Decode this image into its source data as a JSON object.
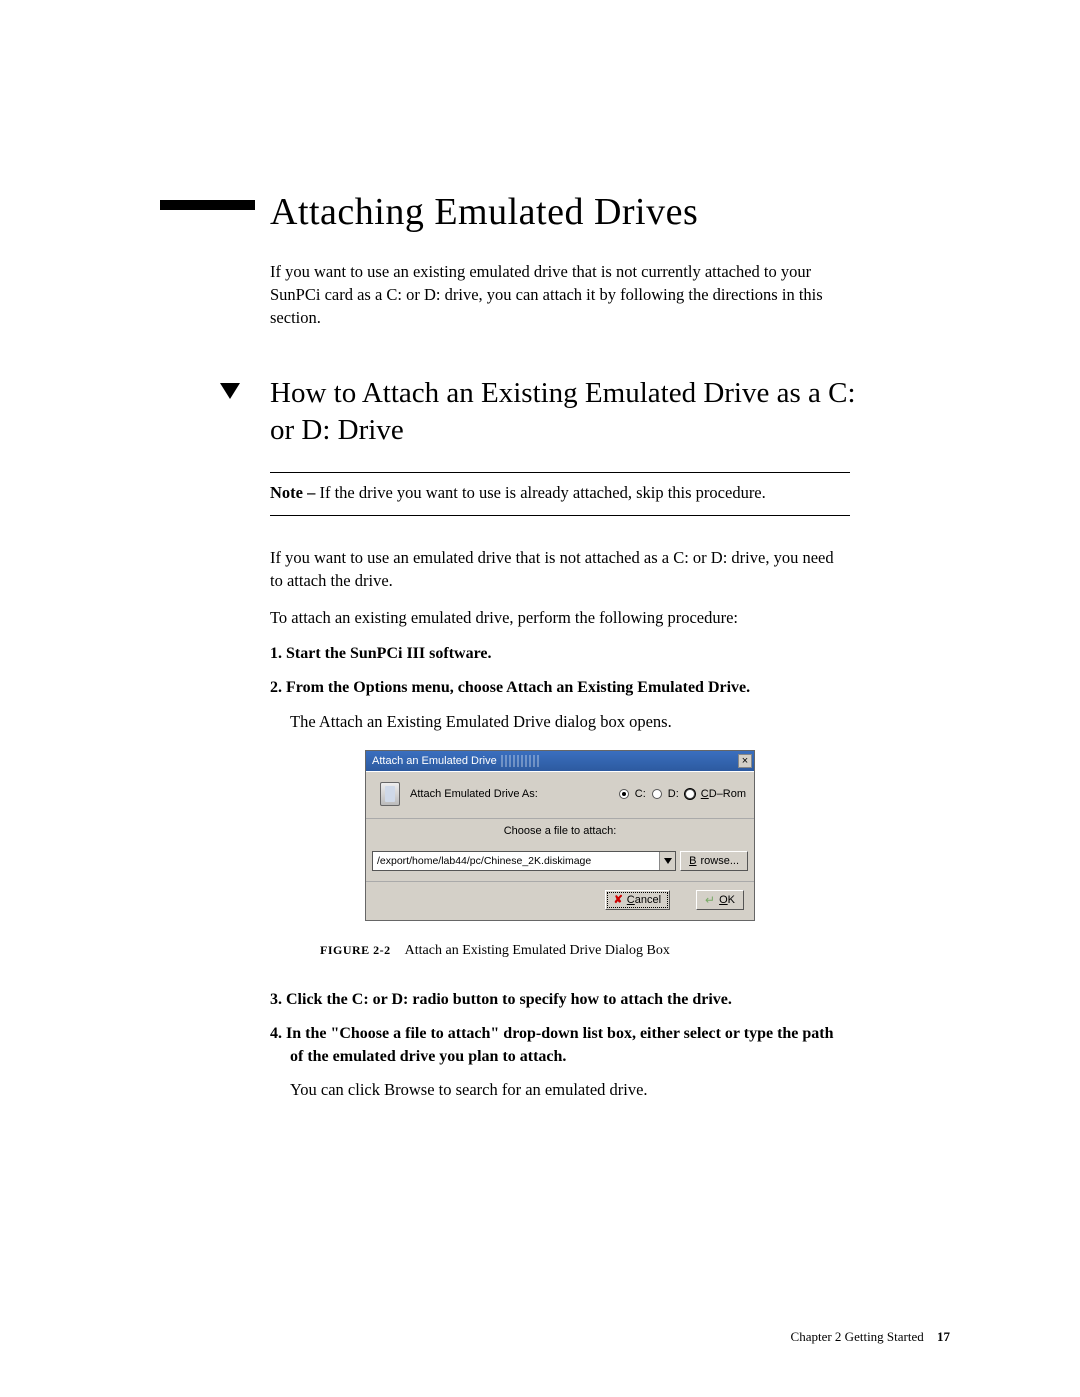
{
  "main_title": "Attaching Emulated Drives",
  "intro": "If you want to use an existing emulated drive that is not currently attached to your SunPCi card as a C: or D: drive, you can attach it by following the directions in this section.",
  "section_heading": "How to Attach an Existing Emulated Drive as a C: or D: Drive",
  "note": {
    "label": "Note –",
    "text": " If the drive you want to use is already attached, skip this procedure."
  },
  "para1": "If you want to use an emulated drive that is not attached as a C: or D: drive, you need to attach the drive.",
  "para2": "To attach an existing emulated drive, perform the following procedure:",
  "steps": {
    "s1": "1. Start the SunPCi III software.",
    "s2": "2. From the Options menu, choose Attach an Existing Emulated Drive.",
    "s2_sub": "The Attach an Existing Emulated Drive dialog box opens.",
    "s3": "3. Click the C: or D: radio button to specify how to attach the drive.",
    "s4": "4. In the \"Choose a file to attach\" drop-down list box, either select or type the path of the emulated drive you plan to attach.",
    "s4_sub": "You can click Browse to search for an emulated drive."
  },
  "dialog": {
    "title": "Attach an Emulated Drive",
    "close": "×",
    "attach_label": "Attach Emulated Drive As:",
    "opt_c": "C:",
    "opt_d": "D:",
    "opt_cd_pre": "C",
    "opt_cd_post": "D–Rom",
    "choose_label": "Choose a file to attach:",
    "path_value": "/export/home/lab44/pc/Chinese_2K.diskimage",
    "browse_pre": "B",
    "browse_post": "rowse...",
    "cancel_pre": "C",
    "cancel_post": "ancel",
    "ok_pre": "O",
    "ok_post": "K"
  },
  "figure": {
    "label": "FIGURE 2-2",
    "text": "Attach an Existing Emulated Drive Dialog Box"
  },
  "footer": {
    "chapter": "Chapter 2   Getting Started",
    "page": "17"
  }
}
